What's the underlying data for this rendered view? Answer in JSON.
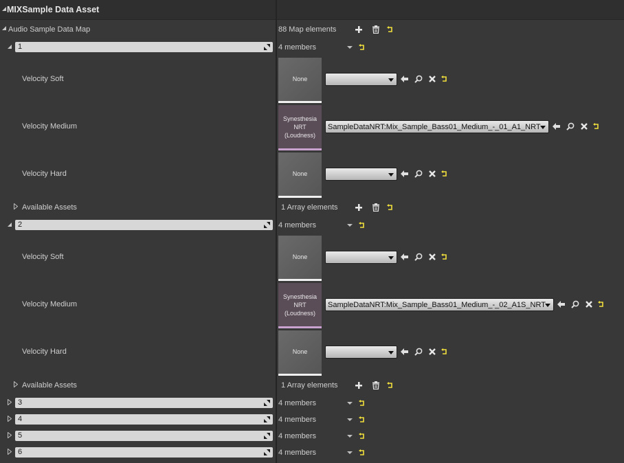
{
  "header": {
    "title": "MIXSample Data Asset"
  },
  "map": {
    "label": "Audio Sample Data Map",
    "count": "88 Map elements"
  },
  "velocity_labels": {
    "soft": "Velocity Soft",
    "medium": "Velocity Medium",
    "hard": "Velocity Hard"
  },
  "thumb_labels": {
    "none": "None",
    "syn_line1": "Synesthesia",
    "syn_line2": "NRT",
    "syn_line3": "(Loudness)"
  },
  "available_assets": {
    "label": "Available Assets",
    "count": "1 Array elements"
  },
  "members_text": "4 members",
  "entries": [
    {
      "key": "1",
      "medium_asset": "SampleDataNRT:Mix_Sample_Bass01_Medium_-_01_A1_NRT"
    },
    {
      "key": "2",
      "medium_asset": "SampleDataNRT:Mix_Sample_Bass01_Medium_-_02_A1S_NRT"
    },
    {
      "key": "3"
    },
    {
      "key": "4"
    },
    {
      "key": "5"
    },
    {
      "key": "6"
    }
  ],
  "icons": {
    "add": "plus-icon",
    "delete": "trash-icon",
    "reset": "reset-arrow-icon",
    "use_selected": "left-arrow-icon",
    "browse": "magnifier-icon",
    "clear": "x-icon",
    "expand": "triangle-icon",
    "resize": "resize-icon"
  },
  "colors": {
    "background": "#383838",
    "header": "#2f2f2f",
    "reset_yellow": "#f2e03c",
    "synesthesia_bar": "#c9a2cf"
  }
}
